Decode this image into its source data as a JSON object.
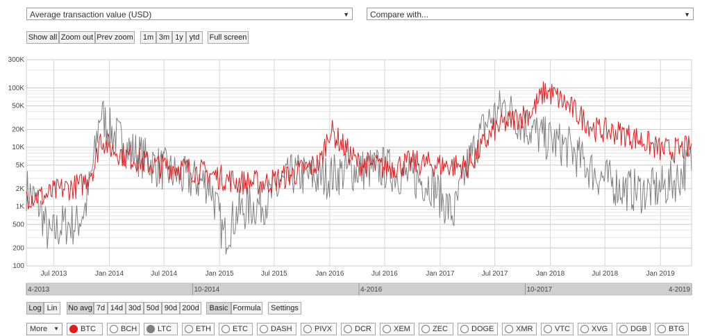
{
  "metric_select": {
    "value": "Average transaction value (USD)"
  },
  "compare_select": {
    "value": "Compare with..."
  },
  "zoom_buttons": [
    "Show all",
    "Zoom out",
    "Prev zoom"
  ],
  "range_buttons": [
    "1m",
    "3m",
    "1y",
    "ytd"
  ],
  "fullscreen_label": "Full screen",
  "scale_buttons": [
    {
      "label": "Log",
      "active": true
    },
    {
      "label": "Lin",
      "active": false
    }
  ],
  "avg_buttons": [
    {
      "label": "No avg",
      "active": true
    },
    {
      "label": "7d",
      "active": false
    },
    {
      "label": "14d",
      "active": false
    },
    {
      "label": "30d",
      "active": false
    },
    {
      "label": "50d",
      "active": false
    },
    {
      "label": "90d",
      "active": false
    },
    {
      "label": "200d",
      "active": false
    }
  ],
  "mode_buttons": [
    {
      "label": "Basic",
      "active": true
    },
    {
      "label": "Formula",
      "active": false
    }
  ],
  "settings_label": "Settings",
  "more_select": {
    "value": "More"
  },
  "coins": [
    {
      "label": "BTC",
      "color": "#e41a1c",
      "active": true
    },
    {
      "label": "BCH",
      "active": false
    },
    {
      "label": "LTC",
      "color": "#7f7f7f",
      "active": true
    },
    {
      "label": "ETH",
      "active": false
    },
    {
      "label": "ETC",
      "active": false
    },
    {
      "label": "DASH",
      "active": false
    },
    {
      "label": "PIVX",
      "active": false
    },
    {
      "label": "DCR",
      "active": false
    },
    {
      "label": "XEM",
      "active": false
    },
    {
      "label": "ZEC",
      "active": false
    },
    {
      "label": "DOGE",
      "active": false
    },
    {
      "label": "XMR",
      "active": false
    },
    {
      "label": "VTC",
      "active": false
    },
    {
      "label": "XVG",
      "active": false
    },
    {
      "label": "DGB",
      "active": false
    },
    {
      "label": "BTG",
      "active": false
    }
  ],
  "chart_data": {
    "type": "line",
    "y_scale": "log",
    "ylim": [
      100,
      300000
    ],
    "y_ticks": [
      {
        "v": 100,
        "label": "100"
      },
      {
        "v": 200,
        "label": "200"
      },
      {
        "v": 500,
        "label": "500"
      },
      {
        "v": 1000,
        "label": "1K"
      },
      {
        "v": 2000,
        "label": "2K"
      },
      {
        "v": 5000,
        "label": "5K"
      },
      {
        "v": 10000,
        "label": "10K"
      },
      {
        "v": 20000,
        "label": "20K"
      },
      {
        "v": 50000,
        "label": "50K"
      },
      {
        "v": 100000,
        "label": "100K"
      },
      {
        "v": 300000,
        "label": "300K"
      }
    ],
    "x_range": [
      "2013-04-01",
      "2019-04-14"
    ],
    "x_ticks": [
      "Jul 2013",
      "Jan 2014",
      "Jul 2014",
      "Jan 2015",
      "Jul 2015",
      "Jan 2016",
      "Jul 2016",
      "Jan 2017",
      "Jul 2017",
      "Jan 2018",
      "Jul 2018",
      "Jan 2019"
    ],
    "navigator_labels": [
      "4-2013",
      "10-2014",
      "4-2016",
      "10-2017",
      "4-2019"
    ],
    "grid": true,
    "series": [
      {
        "name": "BTC",
        "color": "#e41a1c",
        "x": [
          "2013-04-01",
          "2013-06-01",
          "2013-08-01",
          "2013-10-01",
          "2013-11-15",
          "2013-12-01",
          "2014-01-01",
          "2014-03-01",
          "2014-06-01",
          "2014-09-01",
          "2014-12-01",
          "2015-03-01",
          "2015-06-01",
          "2015-09-01",
          "2015-12-01",
          "2016-01-01",
          "2016-04-01",
          "2016-07-01",
          "2016-10-01",
          "2017-01-01",
          "2017-04-01",
          "2017-07-01",
          "2017-09-01",
          "2017-11-01",
          "2017-12-15",
          "2018-01-15",
          "2018-03-01",
          "2018-06-01",
          "2018-09-01",
          "2018-11-01",
          "2019-01-01",
          "2019-03-01",
          "2019-04-14"
        ],
        "values": [
          1500,
          1500,
          2000,
          2300,
          5000,
          15000,
          10000,
          7000,
          5000,
          4500,
          3500,
          2600,
          2500,
          3500,
          5500,
          20000,
          5500,
          4500,
          5500,
          5000,
          4800,
          20000,
          30000,
          40000,
          90000,
          75000,
          50000,
          20000,
          17000,
          13000,
          9000,
          9000,
          10000
        ]
      },
      {
        "name": "LTC",
        "color": "#7f7f7f",
        "x": [
          "2013-04-01",
          "2013-05-15",
          "2013-06-15",
          "2013-08-01",
          "2013-09-15",
          "2013-10-15",
          "2013-11-15",
          "2013-12-01",
          "2014-01-01",
          "2014-03-01",
          "2014-06-01",
          "2014-09-01",
          "2014-12-01",
          "2015-01-15",
          "2015-03-01",
          "2015-06-01",
          "2015-09-01",
          "2015-12-01",
          "2016-03-01",
          "2016-07-01",
          "2016-10-01",
          "2016-12-01",
          "2017-02-15",
          "2017-04-01",
          "2017-06-01",
          "2017-08-01",
          "2017-10-01",
          "2017-12-01",
          "2018-03-01",
          "2018-06-01",
          "2018-09-01",
          "2018-11-01",
          "2019-01-01",
          "2019-03-01",
          "2019-04-14"
        ],
        "values": [
          2000,
          1000,
          300,
          500,
          500,
          1000,
          8000,
          40000,
          20000,
          10000,
          5000,
          3000,
          2500,
          300,
          800,
          1200,
          3500,
          3000,
          4000,
          4500,
          3000,
          2500,
          700,
          5000,
          25000,
          50000,
          25000,
          15000,
          10000,
          3500,
          2000,
          1800,
          2000,
          3000,
          6000
        ]
      }
    ]
  }
}
